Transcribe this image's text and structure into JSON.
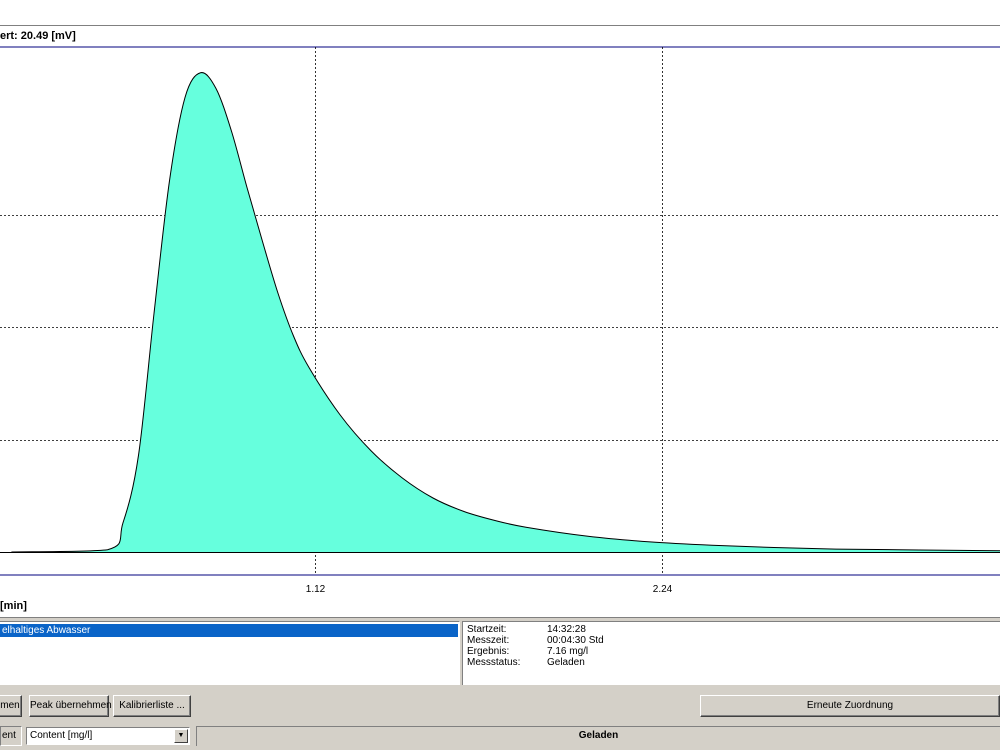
{
  "chart": {
    "header_value": "ert: 20.49 [mV]",
    "unit_label": "[min]"
  },
  "chart_data": {
    "type": "area",
    "title": "",
    "xlabel": "[min]",
    "x_ticks": [
      "1.12",
      "2.24"
    ],
    "xlim": [
      0.14,
      3.36
    ],
    "ylim": [
      0,
      22
    ],
    "grid": true,
    "fill_color": "#66ffdd",
    "line_color": "#000000",
    "x": [
      0.14,
      0.45,
      0.5,
      0.55,
      0.6,
      0.65,
      0.7,
      0.75,
      0.8,
      0.85,
      0.9,
      0.95,
      1.0,
      1.05,
      1.1,
      1.2,
      1.3,
      1.4,
      1.5,
      1.6,
      1.7,
      1.8,
      2.0,
      2.2,
      2.4,
      2.6,
      2.8,
      3.0,
      3.2,
      3.36
    ],
    "values": [
      0.0,
      0.1,
      1.3,
      4.3,
      10.6,
      16.5,
      20.2,
      21.3,
      20.6,
      18.7,
      16.2,
      13.8,
      11.5,
      9.6,
      8.2,
      6.1,
      4.5,
      3.3,
      2.4,
      1.8,
      1.4,
      1.1,
      0.7,
      0.45,
      0.3,
      0.2,
      0.13,
      0.1,
      0.07,
      0.05
    ]
  },
  "sample_list": {
    "selected_item": "elhaltiges Abwasser"
  },
  "info": {
    "rows": [
      {
        "label": "Startzeit:",
        "value": "14:32:28"
      },
      {
        "label": "Messzeit:",
        "value": "00:04:30 Std"
      },
      {
        "label": "Ergebnis:",
        "value": "7.16 mg/l"
      },
      {
        "label": "Messstatus:",
        "value": "Geladen"
      }
    ]
  },
  "buttons": {
    "partial_label": "men",
    "peak_label": "Peak übernehmen",
    "kalibrier_label": "Kalibrierliste ...",
    "zuordnung_label": "Erneute Zuordnung"
  },
  "status": {
    "partial_label": "ent",
    "combo_value": "Content [mg/l]",
    "status_text": "Geladen"
  }
}
